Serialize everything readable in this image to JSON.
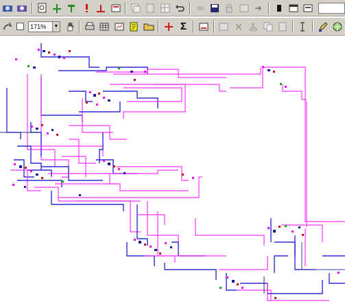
{
  "toolbar": {
    "zoom_value": "171%",
    "sigma_label": "Σ",
    "icons_row1": [
      "view-icon",
      "view2-icon",
      "find-icon",
      "route-green-icon",
      "route-green2-icon",
      "red-flag-icon",
      "red-route-icon",
      "print-icon",
      "copy-icon",
      "paste-icon",
      "layout-icon",
      "undo-icon",
      "cut-icon",
      "save-icon",
      "lock-icon",
      "export-icon",
      "import-icon",
      "black-square-icon",
      "window-icon",
      "panel-icon"
    ],
    "icons_row2": [
      "curve-icon",
      "zoom-box-icon",
      "pan-hand-icon",
      "print-icon",
      "table-icon",
      "chart-icon",
      "report-icon",
      "folder-icon",
      "add-node-icon",
      "sum-icon",
      "snapshot-icon",
      "grid-icon",
      "cross-icon",
      "cut-icon",
      "copy-icon",
      "paste-icon",
      "text-cursor-icon",
      "pencil-icon",
      "globe-icon"
    ]
  },
  "colors": {
    "primary_line": "#2b2bd6",
    "secondary_line": "#ff33ff",
    "toolbar_bg": "#d4d0c8"
  }
}
